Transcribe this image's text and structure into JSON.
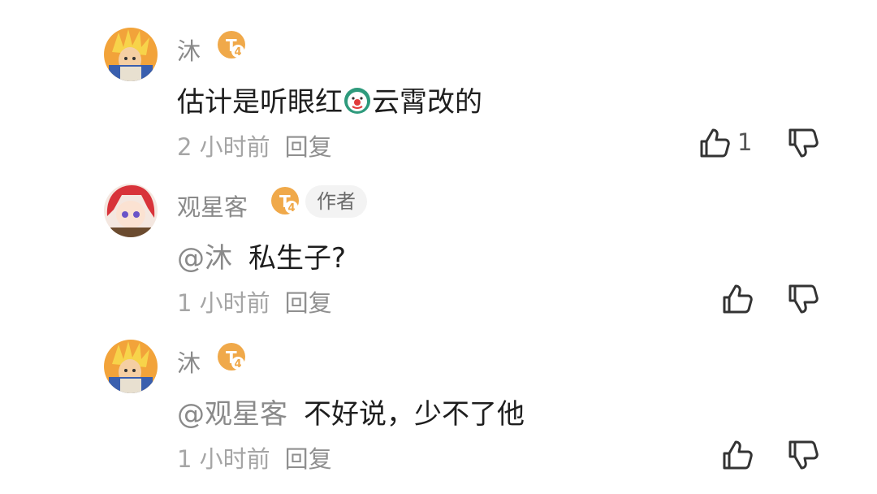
{
  "comments": [
    {
      "username": "沐",
      "level": "4",
      "is_author": false,
      "content_parts": [
        "估计是听眼红",
        "云霄改的"
      ],
      "emoji_icon": "clown-emoji",
      "time": "2 小时前",
      "reply_label": "回复",
      "likes": "1"
    },
    {
      "username": "观星客",
      "level": "4",
      "is_author": true,
      "author_label": "作者",
      "mention": "@沐",
      "content": "私生子?",
      "time": "1 小时前",
      "reply_label": "回复"
    },
    {
      "username": "沐",
      "level": "4",
      "is_author": false,
      "mention": "@观星客",
      "content": "不好说，少不了他",
      "time": "1 小时前",
      "reply_label": "回复"
    }
  ],
  "colors": {
    "level_badge": "#f0a94a",
    "username": "#8a8a8a",
    "content": "#1e1e1e",
    "meta": "#a5a5a5",
    "author_tag_bg": "#f3f3f3"
  }
}
